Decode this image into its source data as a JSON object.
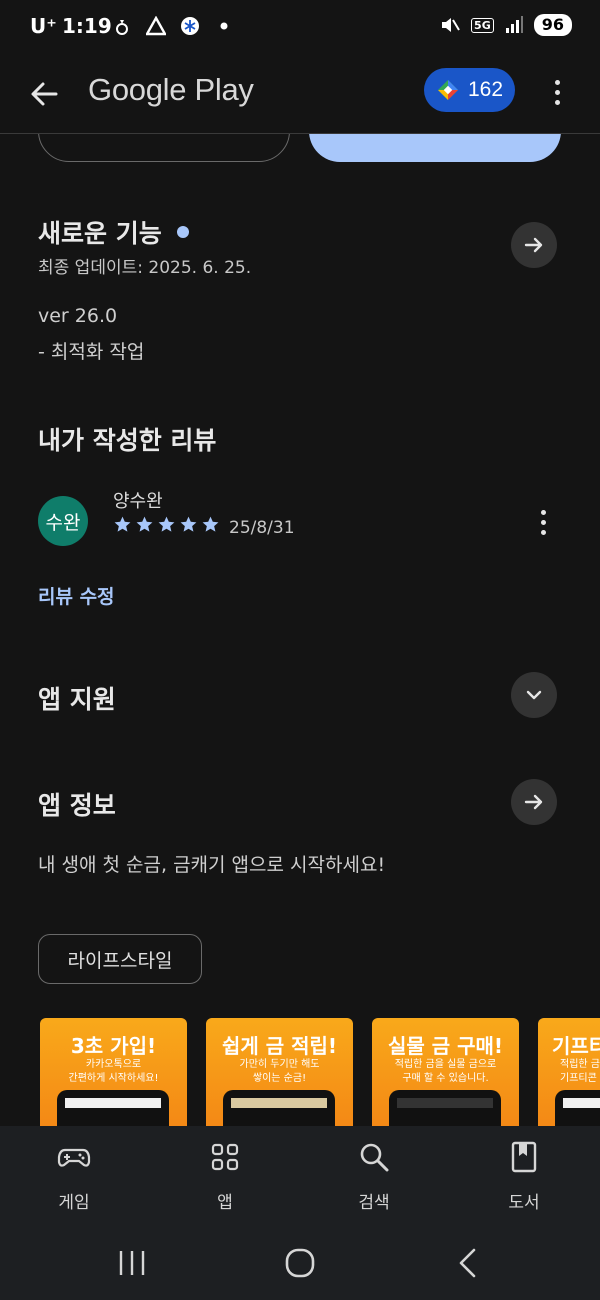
{
  "status_bar": {
    "carrier": "U⁺",
    "time": "1:19",
    "network": "5G",
    "battery": "96"
  },
  "app_bar": {
    "title": "Google Play",
    "points": "162"
  },
  "whats_new": {
    "title": "새로운 기능",
    "updated": "최종 업데이트: 2025. 6. 25.",
    "version": "ver 26.0",
    "notes": "- 최적화 작업"
  },
  "my_review": {
    "title": "내가 작성한 리뷰",
    "avatar_text": "수완",
    "reviewer": "양수완",
    "rating": 5,
    "date": "25/8/31",
    "edit_label": "리뷰 수정"
  },
  "app_support": {
    "title": "앱 지원"
  },
  "app_info": {
    "title": "앱 정보",
    "description": "내 생애 첫 순금, 금캐기 앱으로 시작하세요!",
    "category": "라이프스타일"
  },
  "screenshots": [
    {
      "title": "3초 가입!",
      "sub1": "카카오톡으로",
      "sub2": "간편하게 시작하세요!"
    },
    {
      "title": "쉽게 금 적립!",
      "sub1": "가만히 두기만 해도",
      "sub2": "쌓이는 순금!"
    },
    {
      "title": "실물 금 구매!",
      "sub1": "적립한 금을 실물 금으로",
      "sub2": "구매 할 수 있습니다."
    },
    {
      "title": "기프티",
      "sub1": "적립한 금",
      "sub2": "기프티콘"
    }
  ],
  "bottom_nav": {
    "items": [
      {
        "label": "게임",
        "icon": "gamepad-icon"
      },
      {
        "label": "앱",
        "icon": "apps-grid-icon"
      },
      {
        "label": "검색",
        "icon": "search-icon"
      },
      {
        "label": "도서",
        "icon": "book-icon"
      }
    ]
  },
  "colors": {
    "background": "#141414",
    "accent": "#a8c7fa",
    "points_chip": "#1a56c8",
    "avatar": "#0f7d6a"
  }
}
